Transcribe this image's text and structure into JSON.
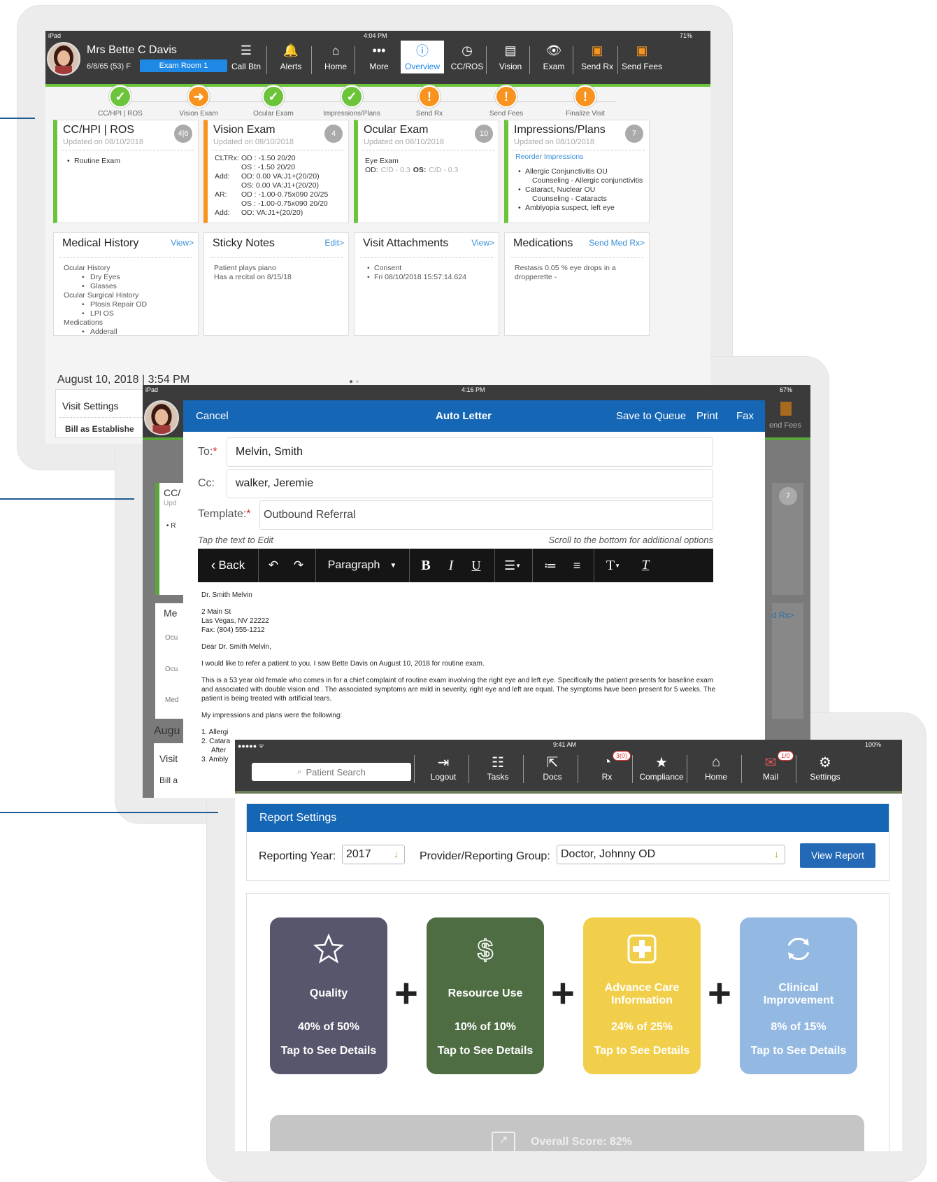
{
  "screen1": {
    "status": {
      "device": "iPad",
      "time": "4:04 PM",
      "battery": "71%"
    },
    "patient": {
      "name": "Mrs Bette C Davis",
      "dob": "6/8/65 (53) F",
      "room": "Exam Room 1"
    },
    "toolbar": [
      "Call Btn",
      "Alerts",
      "Home",
      "More",
      "Overview",
      "CC/ROS",
      "Vision",
      "Exam",
      "Send Rx",
      "Send Fees"
    ],
    "steps": [
      "CC/HPI | ROS",
      "Vision Exam",
      "Ocular Exam",
      "Impressions/Plans",
      "Send Rx",
      "Send Fees",
      "Finalize Visit"
    ],
    "cards": [
      {
        "title": "CC/HPI | ROS",
        "updated": "Updated on 08/10/2018",
        "badge": "4|6",
        "items": [
          "Routine Exam"
        ]
      },
      {
        "title": "Vision Exam",
        "updated": "Updated on 08/10/2018",
        "badge": "4",
        "rows": [
          [
            "CLTRx:",
            "OD : -1.50 20/20"
          ],
          [
            "",
            "OS : -1.50 20/20"
          ],
          [
            "Add:",
            "OD: 0.00 VA:J1+(20/20)"
          ],
          [
            "",
            "OS: 0.00 VA:J1+(20/20)"
          ],
          [
            "AR:",
            "OD : -1.00-0.75x090 20/25"
          ],
          [
            "",
            "OS : -1.00-0.75x090 20/20"
          ],
          [
            "Add:",
            "OD: VA:J1+(20/20)"
          ]
        ]
      },
      {
        "title": "Ocular Exam",
        "updated": "Updated on 08/10/2018",
        "badge": "10",
        "line1": "Eye Exam",
        "od_label": "OD:",
        "od_val": "C/D - 0.3",
        "os_label": "OS:",
        "os_val": "C/D - 0.3"
      },
      {
        "title": "Impressions/Plans",
        "updated": "Updated on 08/10/2018",
        "badge": "7",
        "link": "Reorder Impressions",
        "items": [
          "Allergic Conjunctivitis OU",
          "Counseling - Allergic conjunctivitis",
          "Cataract, Nuclear OU",
          "Counseling - Cataracts",
          "Amblyopia suspect, left eye"
        ]
      }
    ],
    "cards2": [
      {
        "title": "Medical History",
        "link": "View>",
        "lines": [
          "Ocular History",
          "Dry Eyes",
          "Glasses",
          "Ocular Surgical History",
          "Ptosis Repair OD",
          "LPI OS",
          "Medications",
          "Adderall"
        ]
      },
      {
        "title": "Sticky Notes",
        "link": "Edit>",
        "lines": [
          "Patient plays piano",
          "Has a recital on 8/15/18"
        ]
      },
      {
        "title": "Visit Attachments",
        "link": "View>",
        "lines": [
          "Consent",
          "Fri 08/10/2018 15:57:14.624"
        ]
      },
      {
        "title": "Medications",
        "link": "Send Med Rx>",
        "lines": [
          "Restasis 0.05 % eye drops in a dropperette -"
        ]
      }
    ],
    "date": "August 10, 2018 | 3:54 PM",
    "visit_settings": "Visit Settings",
    "bill": "Bill as Establishe"
  },
  "screen2": {
    "status": {
      "device": "iPad",
      "time": "4:16 PM",
      "battery": "67%"
    },
    "header": {
      "cancel": "Cancel",
      "title": "Auto Letter",
      "save": "Save to Queue",
      "print": "Print",
      "fax": "Fax"
    },
    "to_label": "To:",
    "to": "Melvin, Smith",
    "cc_label": "Cc:",
    "cc": "walker, Jeremie",
    "template_label": "Template:",
    "template": "Outbound Referral",
    "hint_left": "Tap the text to Edit",
    "hint_right": "Scroll to the bottom for additional options",
    "editor": {
      "back": "Back",
      "paragraph": "Paragraph"
    },
    "letter": {
      "addressee": "Dr. Smith Melvin",
      "addr1": "2 Main St",
      "addr2": "Las Vegas, NV 22222",
      "addr3": "Fax: (804) 555-1212",
      "greeting": "Dear Dr. Smith Melvin,",
      "p1": "I would like to refer a patient to you. I saw Bette Davis on August 10, 2018 for routine exam.",
      "p2": "This is a 53 year old female who comes in for a chief complaint of routine exam involving the right eye and left eye. Specifically the patient presents for baseline exam and associated with double vision and . The associated symptoms are mild in severity, right eye and left are equal. The symptoms have been present for 5 weeks. The patient is being treated with artificial tears.",
      "p3": "My impressions and plans were the following:",
      "list": [
        "1. Allergi",
        "2. Catara",
        "After",
        "3. Ambly"
      ]
    },
    "behind": {
      "cc": "CC/",
      "upd": "Upd",
      "r": "R",
      "me": "Me",
      "oc1": "Ocu",
      "oc2": "Ocu",
      "med": "Med",
      "aug": "Augu",
      "visit": "Visit",
      "bill": "Bill a",
      "rx": "d Rx>",
      "end_fees": "end Fees",
      "seven": "7"
    }
  },
  "screen3": {
    "status": {
      "time": "9:41 AM",
      "battery": "100%"
    },
    "search_placeholder": "Patient Search",
    "toolbar": [
      "Logout",
      "Tasks",
      "Docs",
      "Rx",
      "Compliance",
      "Home",
      "Mail",
      "Settings"
    ],
    "rx_badge": "3(0)",
    "mail_badge": "1/0",
    "report_settings": "Report Settings",
    "year_label": "Reporting Year:",
    "year": "2017",
    "provider_label": "Provider/Reporting Group:",
    "provider": "Doctor, Johnny OD",
    "view_report": "View Report",
    "metrics": [
      {
        "title": "Quality",
        "pct": "40% of 50%",
        "cta": "Tap to See Details",
        "color": "#58566d",
        "icon": "star-icon"
      },
      {
        "title": "Resource Use",
        "pct": "10% of 10%",
        "cta": "Tap to See Details",
        "color": "#4e6d43",
        "icon": "dollar-icon"
      },
      {
        "title": "Advance Care Information",
        "pct": "24% of 25%",
        "cta": "Tap to See Details",
        "color": "#f2cf4a",
        "icon": "plus-box-icon"
      },
      {
        "title": "Clinical Improvement",
        "pct": "8% of 15%",
        "cta": "Tap to See Details",
        "color": "#93b8e2",
        "icon": "refresh-icon"
      }
    ],
    "overall": "Overall Score: 82%"
  },
  "colors": {
    "blue": "#1566b5",
    "green": "#6bc43a",
    "orange": "#f7931e",
    "line": "#1f5b93"
  }
}
